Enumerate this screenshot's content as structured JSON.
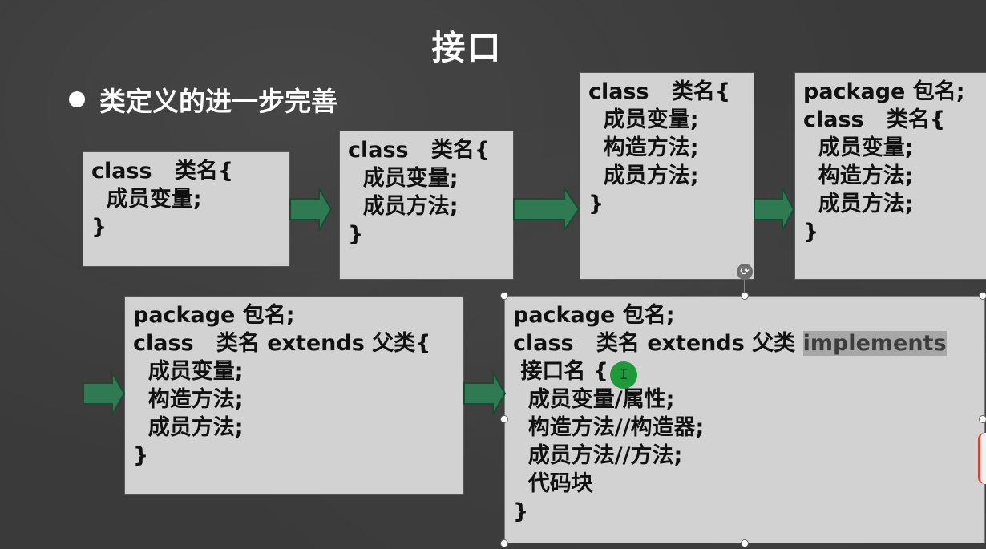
{
  "slide": {
    "title": "接口",
    "bullet": "类定义的进一步完善"
  },
  "boxes": [
    {
      "lines": [
        "class   类名{",
        "  成员变量;",
        "}"
      ]
    },
    {
      "lines": [
        "class   类名{",
        "  成员变量;",
        "  成员方法;",
        "}"
      ]
    },
    {
      "lines": [
        "class   类名{",
        "  成员变量;",
        "  构造方法;",
        "  成员方法;",
        "}"
      ]
    },
    {
      "lines": [
        "package 包名;",
        "class   类名{",
        "  成员变量;",
        "  构造方法;",
        "  成员方法;",
        "}"
      ]
    },
    {
      "lines": [
        "package 包名;",
        "class   类名 extends 父类{",
        "  成员变量;",
        "  构造方法;",
        "  成员方法;",
        "}"
      ]
    },
    {
      "line1": "package 包名;",
      "line2_prefix": "class   类名 extends 父类 ",
      "line2_highlight": "implements",
      "line3": " 接口名 {",
      "line4": "  成员变量/属性;",
      "line5": "  构造方法//构造器;",
      "line6": "  成员方法//方法;",
      "line7": "  代码块",
      "line8": "}"
    }
  ],
  "cursor_glyph": "I",
  "rotate_glyph": "⟳",
  "colors": {
    "arrow_fill": "#2f7a52",
    "arrow_stroke": "#1c4a31",
    "box_bg": "#d2d2d2",
    "cursor_green": "#1f9a3a"
  }
}
